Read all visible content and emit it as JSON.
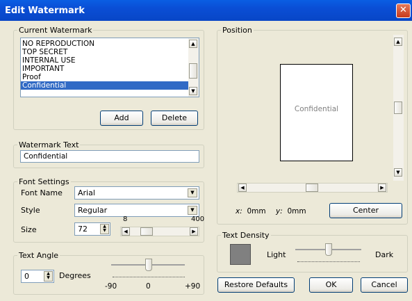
{
  "window": {
    "title": "Edit Watermark",
    "close_glyph": "✕"
  },
  "current_watermark": {
    "group_label": "Current Watermark",
    "items": [
      "NO REPRODUCTION",
      "TOP SECRET",
      "INTERNAL USE",
      "IMPORTANT",
      "Proof",
      "Confidential"
    ],
    "selected_index": 5,
    "add_label": "Add",
    "delete_label": "Delete"
  },
  "watermark_text": {
    "group_label": "Watermark Text",
    "value": "Confidential"
  },
  "font_settings": {
    "group_label": "Font Settings",
    "font_name_label": "Font Name",
    "font_name_value": "Arial",
    "style_label": "Style",
    "style_value": "Regular",
    "size_label": "Size",
    "size_value": "72",
    "size_min_label": "8",
    "size_max_label": "400"
  },
  "text_angle": {
    "group_label": "Text Angle",
    "value": "0",
    "unit_label": "Degrees",
    "scale_labels": [
      "-90",
      "0",
      "+90"
    ]
  },
  "position": {
    "group_label": "Position",
    "preview_text": "Confidential",
    "x_label": "x:",
    "x_value": "0mm",
    "y_label": "y:",
    "y_value": "0mm",
    "center_label": "Center"
  },
  "text_density": {
    "group_label": "Text Density",
    "light_label": "Light",
    "dark_label": "Dark",
    "swatch_color": "#808080"
  },
  "footer": {
    "restore_label": "Restore Defaults",
    "ok_label": "OK",
    "cancel_label": "Cancel"
  },
  "colors": {
    "title_blue": "#0a4ed5",
    "selection": "#316ac5",
    "dialog_bg": "#ece9d8"
  }
}
